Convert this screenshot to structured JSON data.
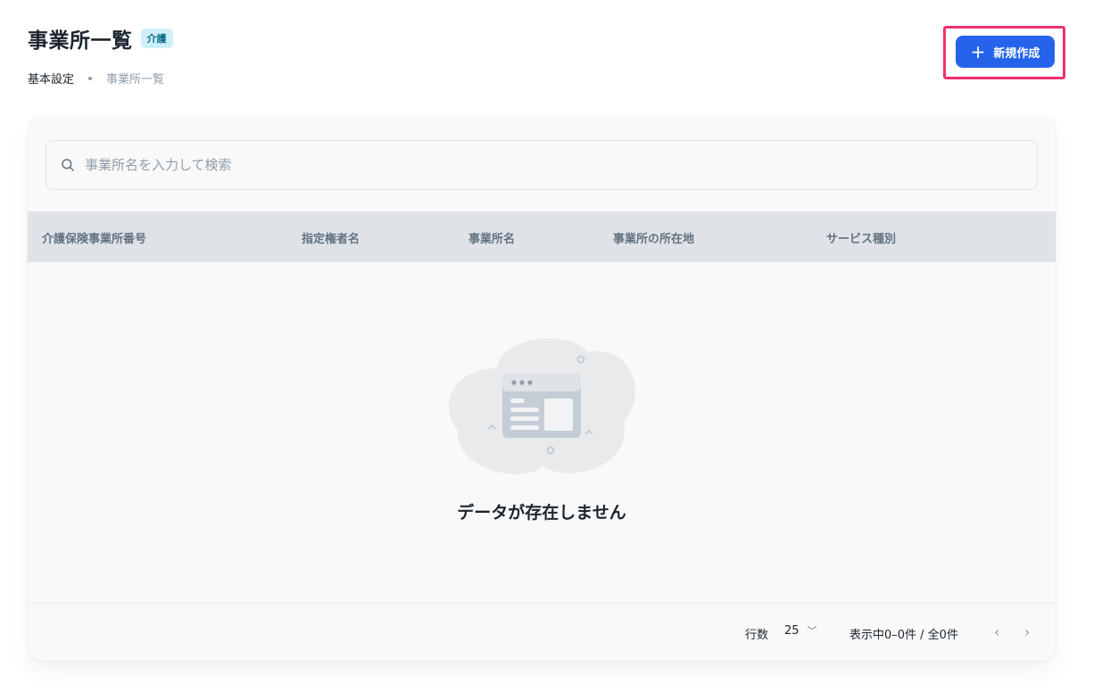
{
  "header": {
    "title": "事業所一覧",
    "tag": "介護",
    "breadcrumb": {
      "parent": "基本設定",
      "current": "事業所一覧"
    }
  },
  "actions": {
    "new_button_label": "新規作成",
    "new_button_icon": "plus-icon"
  },
  "search": {
    "placeholder": "事業所名を入力して検索",
    "value": "",
    "icon": "search-icon"
  },
  "table": {
    "columns": [
      "介護保険事業所番号",
      "指定権者名",
      "事業所名",
      "事業所の所在地",
      "サービス種別"
    ],
    "rows": [],
    "empty_message": "データが存在しません"
  },
  "pagination": {
    "rows_label": "行数",
    "rows_per_page": "25",
    "range_text": "表示中0–0件 / 全0件"
  },
  "colors": {
    "accent": "#2563eb",
    "highlight": "#f0316d",
    "header_bg": "#dfe3e8"
  }
}
